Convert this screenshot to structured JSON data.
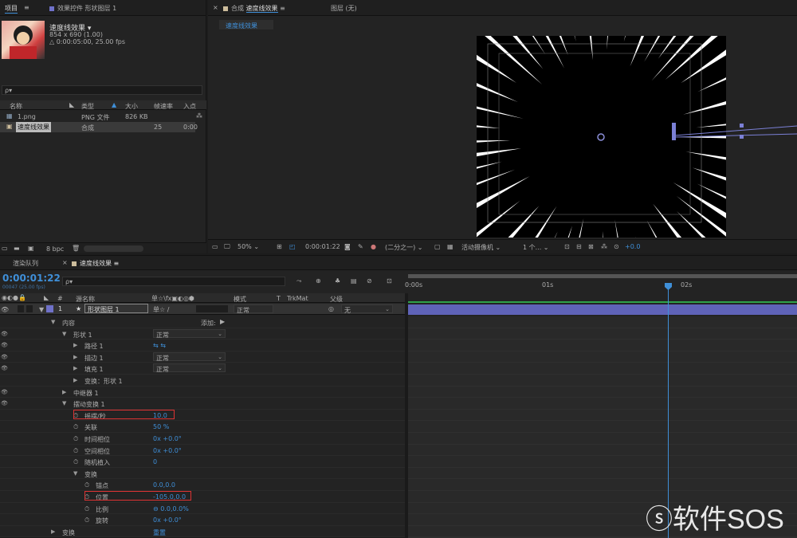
{
  "project": {
    "tab_label": "项目",
    "tab_menu": "≡",
    "effect_tab": "效果控件 形状图层 1",
    "comp_name": "速度线效果 ▾",
    "comp_size": "854 x 690 (1.00)",
    "comp_duration": "△ 0:00:05:00, 25.00 fps",
    "search_placeholder": "ρ▾",
    "columns": [
      "名称",
      "类型",
      "大小",
      "帧速率",
      "入点"
    ],
    "items": [
      {
        "name": "1.png",
        "type": "PNG 文件",
        "size": "826 KB",
        "fps": "",
        "in": ""
      },
      {
        "name": "速度线效果",
        "type": "合成",
        "size": "",
        "fps": "25",
        "in": "0:00"
      }
    ],
    "bpc": "8 bpc",
    "color_png": "#8b8ed8",
    "color_comp": "#c8b89a"
  },
  "comp": {
    "tab_close": "×",
    "tab_label": "合成",
    "tab_name": "速度线效果",
    "tab_menu": "≡",
    "layer_tab": "图层 (无)",
    "sub_tab": "速度线效果",
    "zoom": "50%",
    "timecode": "0:00:01:22",
    "resolution": "(二分之一)",
    "camera": "活动摄像机",
    "views": "1 个...",
    "exposure": "+0.0"
  },
  "timeline": {
    "render_tab": "渲染队列",
    "tab_close": "×",
    "comp_tab": "速度线效果",
    "tab_menu": "≡",
    "timecode": "0:00:01:22",
    "frame_info": "00047 (25.00 fps)",
    "search_placeholder": "ρ▾",
    "col_num": "#",
    "col_source": "源名称",
    "col_mode": "模式",
    "col_t": "T",
    "col_trkmat": "TrkMat",
    "col_parent": "父级",
    "switch_icons": "单☆\\fx▣◐◎⬢",
    "ruler": [
      "0:00s",
      "01s",
      "02s"
    ],
    "layer": {
      "num": "1",
      "name": "形状图层 1",
      "mode": "正常",
      "parent": "无",
      "star": "★"
    },
    "add_label": "添加:",
    "props": [
      {
        "label": "内容",
        "level": 1,
        "tri": "▼",
        "eye": false
      },
      {
        "label": "形状 1",
        "level": 2,
        "tri": "▼",
        "eye": true,
        "dd": "正常"
      },
      {
        "label": "路径 1",
        "level": 3,
        "tri": "▶",
        "eye": true,
        "icons": "⇆ ⇆"
      },
      {
        "label": "描边 1",
        "level": 3,
        "tri": "▶",
        "eye": true,
        "dd": "正常"
      },
      {
        "label": "填充 1",
        "level": 3,
        "tri": "▶",
        "eye": true,
        "dd": "正常"
      },
      {
        "label": "变换：形状 1",
        "level": 3,
        "tri": "▶",
        "eye": false
      },
      {
        "label": "中继器 1",
        "level": 2,
        "tri": "▶",
        "eye": true
      },
      {
        "label": "摆动变换 1",
        "level": 2,
        "tri": "▼",
        "eye": true
      },
      {
        "label": "摇摆/秒",
        "level": 3,
        "stop": true,
        "value": "10.0",
        "highlight": true
      },
      {
        "label": "关联",
        "level": 3,
        "stop": true,
        "value": "50 %"
      },
      {
        "label": "时间相位",
        "level": 3,
        "stop": true,
        "value": "0x +0.0°"
      },
      {
        "label": "空间相位",
        "level": 3,
        "stop": true,
        "value": "0x +0.0°"
      },
      {
        "label": "随机植入",
        "level": 3,
        "stop": true,
        "value": "0"
      },
      {
        "label": "变换",
        "level": 3,
        "tri": "▼"
      },
      {
        "label": "锚点",
        "level": 4,
        "stop": true,
        "value": "0.0,0.0"
      },
      {
        "label": "位置",
        "level": 4,
        "stop": true,
        "value": "-105.0,0.0",
        "highlight": true
      },
      {
        "label": "比例",
        "level": 4,
        "stop": true,
        "value": "⊖ 0.0,0.0%"
      },
      {
        "label": "旋转",
        "level": 4,
        "stop": true,
        "value": "0x +0.0°"
      },
      {
        "label": "变换",
        "level": 1,
        "tri": "▶",
        "value": "重置"
      }
    ]
  },
  "watermark": {
    "text": "软件SOS"
  }
}
